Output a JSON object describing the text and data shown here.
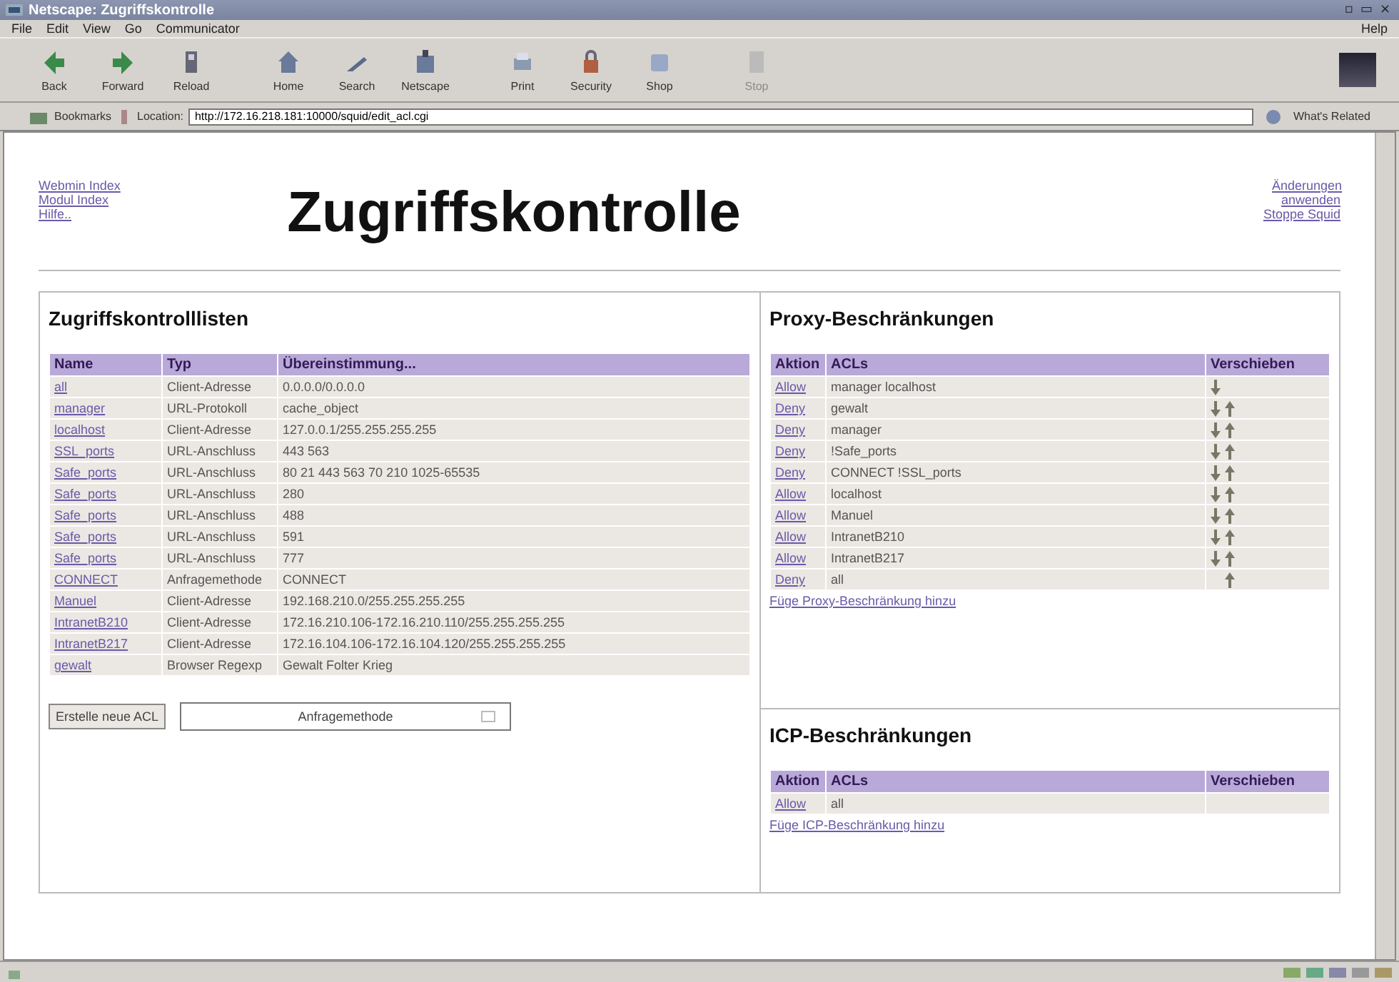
{
  "window": {
    "title": "Netscape: Zugriffskontrolle",
    "controls": [
      "▫",
      "▭",
      "×"
    ]
  },
  "menu": [
    "File",
    "Edit",
    "View",
    "Go",
    "Communicator"
  ],
  "help_menu": "Help",
  "toolbar": [
    {
      "label": "Back",
      "kind": "back",
      "disabled": false
    },
    {
      "label": "Forward",
      "kind": "forward",
      "disabled": false
    },
    {
      "label": "Reload",
      "kind": "reload",
      "disabled": false
    },
    {
      "label": "Home",
      "kind": "home",
      "disabled": false
    },
    {
      "label": "Search",
      "kind": "search",
      "disabled": false
    },
    {
      "label": "Netscape",
      "kind": "netscape",
      "disabled": false
    },
    {
      "label": "Print",
      "kind": "print",
      "disabled": false
    },
    {
      "label": "Security",
      "kind": "security",
      "disabled": false
    },
    {
      "label": "Shop",
      "kind": "shop",
      "disabled": false
    },
    {
      "label": "Stop",
      "kind": "stop",
      "disabled": true
    }
  ],
  "location_bar": {
    "bookmarks": "Bookmarks",
    "location_label": "Location:",
    "url": "http://172.16.218.181:10000/squid/edit_acl.cgi",
    "related": "What's Related"
  },
  "page": {
    "title": "Zugriffskontrolle",
    "left_links": [
      "Webmin Index",
      "Modul Index",
      "Hilfe.."
    ],
    "right_links": [
      "Änderungen anwenden",
      "Stoppe Squid"
    ],
    "acl_section": {
      "heading": "Zugriffskontrolllisten",
      "columns": [
        "Name",
        "Typ",
        "Übereinstimmung..."
      ],
      "rows": [
        [
          "all",
          "Client-Adresse",
          "0.0.0.0/0.0.0.0"
        ],
        [
          "manager",
          "URL-Protokoll",
          "cache_object"
        ],
        [
          "localhost",
          "Client-Adresse",
          "127.0.0.1/255.255.255.255"
        ],
        [
          "SSL_ports",
          "URL-Anschluss",
          "443 563"
        ],
        [
          "Safe_ports",
          "URL-Anschluss",
          "80 21 443 563 70 210 1025-65535"
        ],
        [
          "Safe_ports",
          "URL-Anschluss",
          "280"
        ],
        [
          "Safe_ports",
          "URL-Anschluss",
          "488"
        ],
        [
          "Safe_ports",
          "URL-Anschluss",
          "591"
        ],
        [
          "Safe_ports",
          "URL-Anschluss",
          "777"
        ],
        [
          "CONNECT",
          "Anfragemethode",
          "CONNECT"
        ],
        [
          "Manuel",
          "Client-Adresse",
          "192.168.210.0/255.255.255.255"
        ],
        [
          "IntranetB210",
          "Client-Adresse",
          "172.16.210.106-172.16.210.110/255.255.255.255"
        ],
        [
          "IntranetB217",
          "Client-Adresse",
          "172.16.104.106-172.16.104.120/255.255.255.255"
        ],
        [
          "gewalt",
          "Browser Regexp",
          "Gewalt Folter Krieg"
        ]
      ],
      "create_button": "Erstelle neue ACL",
      "type_select": "Anfragemethode"
    },
    "proxy_section": {
      "heading": "Proxy-Beschränkungen",
      "columns": [
        "Aktion",
        "ACLs",
        "Verschieben"
      ],
      "rows": [
        {
          "action": "Allow",
          "acls": "manager localhost",
          "down": true,
          "up": false
        },
        {
          "action": "Deny",
          "acls": "gewalt",
          "down": true,
          "up": true
        },
        {
          "action": "Deny",
          "acls": "manager",
          "down": true,
          "up": true
        },
        {
          "action": "Deny",
          "acls": "!Safe_ports",
          "down": true,
          "up": true
        },
        {
          "action": "Deny",
          "acls": "CONNECT !SSL_ports",
          "down": true,
          "up": true
        },
        {
          "action": "Allow",
          "acls": "localhost",
          "down": true,
          "up": true
        },
        {
          "action": "Allow",
          "acls": "Manuel",
          "down": true,
          "up": true
        },
        {
          "action": "Allow",
          "acls": "IntranetB210",
          "down": true,
          "up": true
        },
        {
          "action": "Allow",
          "acls": "IntranetB217",
          "down": true,
          "up": true
        },
        {
          "action": "Deny",
          "acls": "all",
          "down": false,
          "up": true
        }
      ],
      "add_link": "Füge Proxy-Beschränkung hinzu"
    },
    "icp_section": {
      "heading": "ICP-Beschränkungen",
      "columns": [
        "Aktion",
        "ACLs",
        "Verschieben"
      ],
      "rows": [
        {
          "action": "Allow",
          "acls": "all"
        }
      ],
      "add_link": "Füge ICP-Beschränkung hinzu"
    }
  }
}
